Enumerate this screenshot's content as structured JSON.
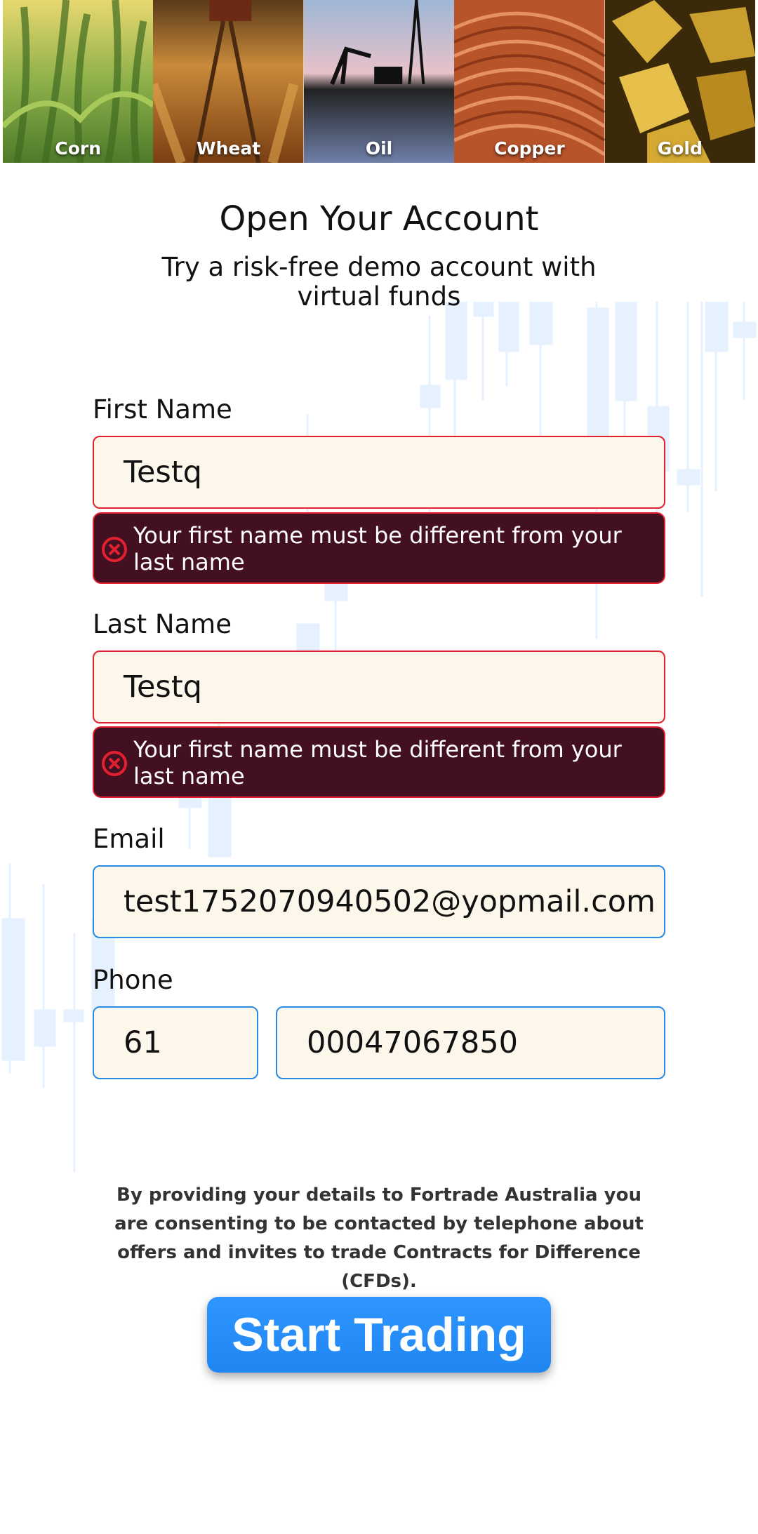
{
  "banner": {
    "tiles": [
      {
        "label": "Corn"
      },
      {
        "label": "Wheat"
      },
      {
        "label": "Oil"
      },
      {
        "label": "Copper"
      },
      {
        "label": "Gold"
      }
    ]
  },
  "header": {
    "title": "Open Your Account",
    "subtitle": "Try a risk-free demo account with virtual funds"
  },
  "form": {
    "first_name": {
      "label": "First Name",
      "value": "Testq",
      "error": "Your first name must be different from your last name"
    },
    "last_name": {
      "label": "Last Name",
      "value": "Testq",
      "error": "Your first name must be different from your last name"
    },
    "email": {
      "label": "Email",
      "value": "test1752070940502@yopmail.com"
    },
    "phone": {
      "label": "Phone",
      "country_code": "61",
      "number": "00047067850"
    }
  },
  "disclaimer": "By providing your details to Fortrade Australia you are consenting to be contacted by telephone about offers and invites to trade Contracts for Difference (CFDs).",
  "cta": {
    "label": "Start Trading"
  },
  "colors": {
    "error_border": "#e32030",
    "error_bg": "#421021",
    "input_bg": "#fdf6ea",
    "input_border_ok": "#2a8be6",
    "cta_bg": "#1f86f2"
  }
}
